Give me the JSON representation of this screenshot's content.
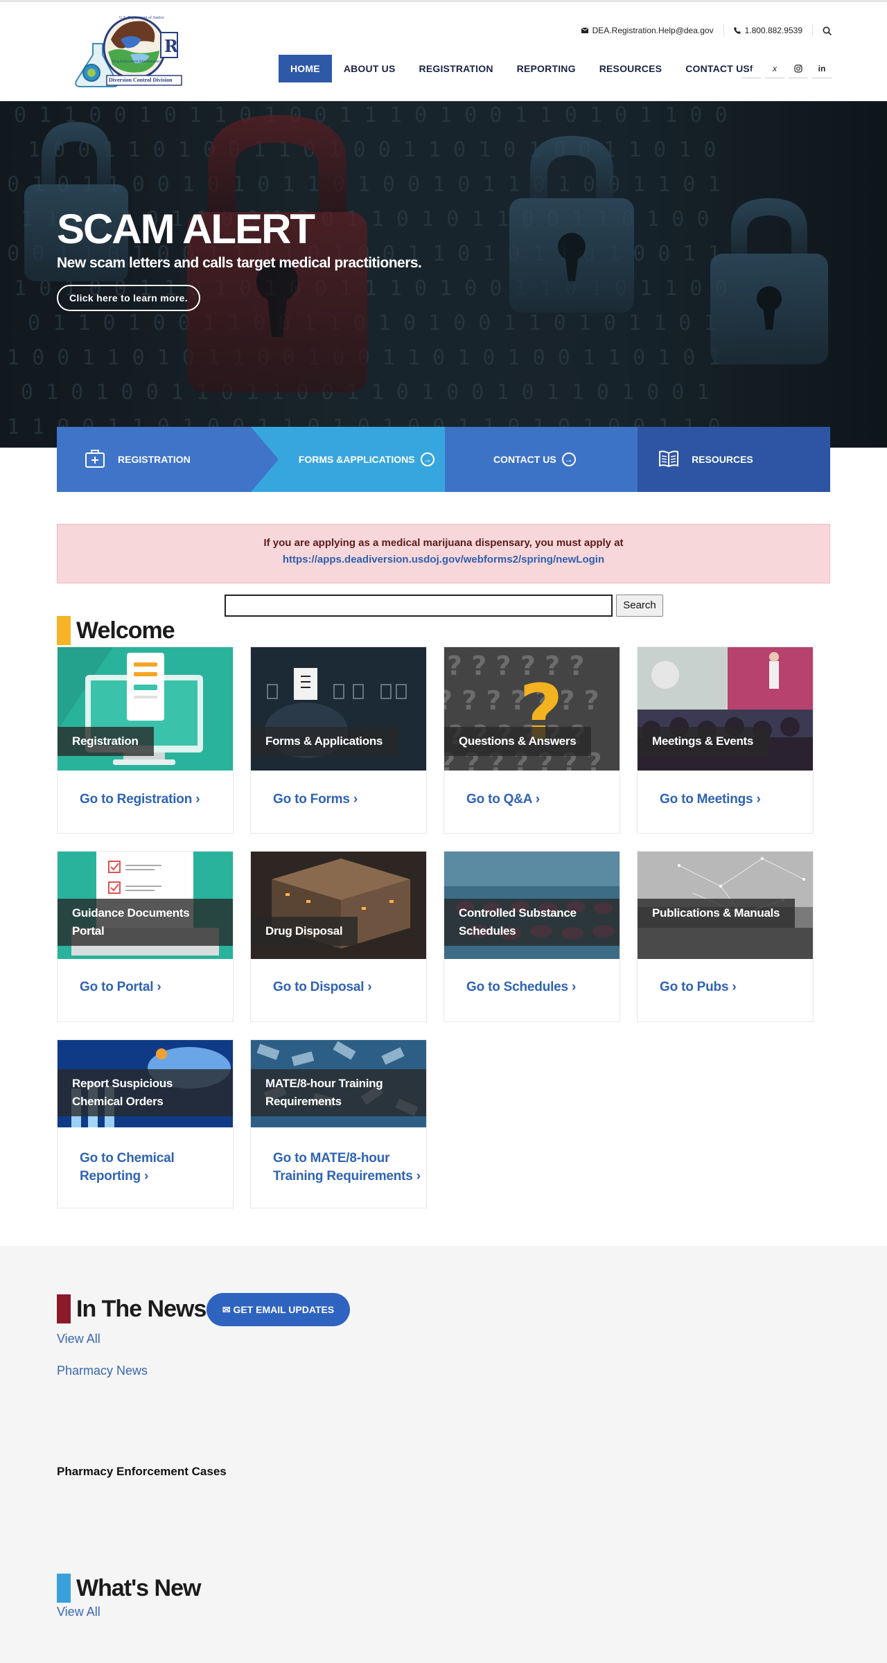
{
  "header": {
    "logo_alt": "Drug Enforcement Administration - Diversion Control Division",
    "logo_text": {
      "top": "U.S. Department of Justice",
      "middle": "Drug Enforcement Administration",
      "bottom": "Diversion Control Division"
    },
    "email": "DEA.Registration.Help@dea.gov",
    "phone": "1.800.882.9539",
    "nav": [
      {
        "label": "HOME",
        "active": true
      },
      {
        "label": "ABOUT US",
        "active": false
      },
      {
        "label": "REGISTRATION",
        "active": false
      },
      {
        "label": "REPORTING",
        "active": false
      },
      {
        "label": "RESOURCES",
        "active": false
      },
      {
        "label": "CONTACT US",
        "active": false
      }
    ],
    "social": [
      "f",
      "X",
      "ig",
      "in"
    ]
  },
  "hero": {
    "title": "SCAM ALERT",
    "subtitle": "New scam letters and calls target medical practitioners.",
    "button": "Click here to learn more."
  },
  "quick_links": [
    {
      "label": "REGISTRATION",
      "icon": "briefcase-medical-icon"
    },
    {
      "label": "FORMS &APPLICATIONS",
      "icon": "arrow-circle-icon"
    },
    {
      "label": "CONTACT US",
      "icon": "arrow-circle-icon"
    },
    {
      "label": "RESOURCES",
      "icon": "book-open-icon"
    }
  ],
  "alert": {
    "line": "If you are applying as a medical marijuana dispensary, you must apply at",
    "link": "https://apps.deadiversion.usdoj.gov/webforms2/spring/newLogin"
  },
  "search": {
    "value": "",
    "button": "Search"
  },
  "welcome": {
    "title": "Welcome",
    "cards": [
      {
        "label": "Registration",
        "link": "Go to Registration"
      },
      {
        "label": "Forms & Applications",
        "link": "Go to Forms"
      },
      {
        "label": "Questions & Answers",
        "link": "Go to Q&A"
      },
      {
        "label": "Meetings & Events",
        "link": "Go to Meetings"
      },
      {
        "label": "Guidance Documents Portal",
        "link": "Go to Portal"
      },
      {
        "label": "Drug Disposal",
        "link": "Go to Disposal"
      },
      {
        "label": "Controlled Substance Schedules",
        "link": "Go to Schedules"
      },
      {
        "label": "Publications & Manuals",
        "link": "Go to Pubs"
      },
      {
        "label": "Report Suspicious Chemical Orders",
        "link": "Go to Chemical Reporting"
      },
      {
        "label": "MATE/8-hour Training Requirements",
        "link": "Go to MATE/8-hour Training Requirements"
      }
    ]
  },
  "news": {
    "title": "In The News",
    "email_button": "GET EMAIL UPDATES",
    "view_all": "View All",
    "pharmacy_news": "Pharmacy News",
    "enforcement": "Pharmacy Enforcement Cases"
  },
  "whats_new": {
    "title": "What's New",
    "view_all": "View All"
  },
  "colors": {
    "nav_active": "#2e59a8",
    "link_blue": "#2f63b4",
    "welcome_bar": "#f5b325",
    "news_bar": "#8b1a2a",
    "whats_new_bar": "#3aa0dc",
    "alert_bg": "#f8d7da"
  }
}
